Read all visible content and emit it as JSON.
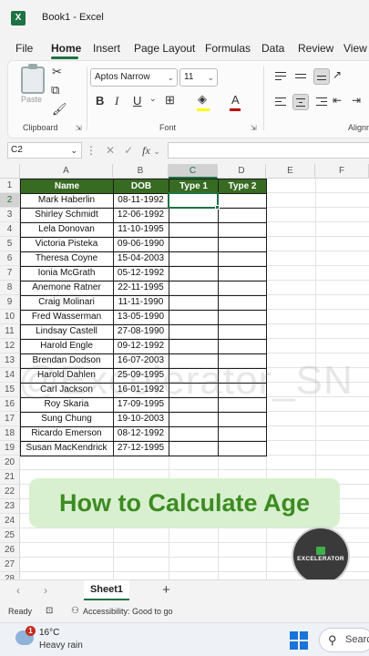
{
  "app": {
    "logo_letter": "X",
    "title": "Book1  -  Excel",
    "accent_color": "#1f7244"
  },
  "menu": {
    "tabs": [
      "File",
      "Home",
      "Insert",
      "Page Layout",
      "Formulas",
      "Data",
      "Review",
      "View"
    ],
    "active": "Home"
  },
  "ribbon": {
    "paste_label": "Paste",
    "clipboard_label": "Clipboard",
    "font_group_label": "Font",
    "alignment_label": "Alignm",
    "font_name": "Aptos Narrow",
    "font_size": "11",
    "bold": "B",
    "italic": "I",
    "underline": "U",
    "font_color_letter": "A",
    "highlight_color": "#ffff00",
    "font_color": "#c00000"
  },
  "formula_bar": {
    "name_box": "C2",
    "cancel_glyph": "✕",
    "enter_glyph": "✓",
    "fx_label": "fx",
    "formula": ""
  },
  "grid": {
    "columns": [
      "A",
      "B",
      "C",
      "D",
      "E",
      "F"
    ],
    "selected_column": "C",
    "selected_row": "2",
    "row_numbers": [
      "1",
      "2",
      "3",
      "4",
      "5",
      "6",
      "7",
      "8",
      "9",
      "10",
      "11",
      "12",
      "13",
      "14",
      "15",
      "16",
      "17",
      "18",
      "19",
      "20",
      "21",
      "22",
      "23",
      "24",
      "25",
      "26",
      "27",
      "28"
    ],
    "headers": [
      "Name",
      "DOB",
      "Type 1",
      "Type 2"
    ],
    "header_fill": "#376b22",
    "rows": [
      [
        "Mark Haberlin",
        "08-11-1992"
      ],
      [
        "Shirley Schmidt",
        "12-06-1992"
      ],
      [
        "Lela Donovan",
        "11-10-1995"
      ],
      [
        "Victoria Pisteka",
        "09-06-1990"
      ],
      [
        "Theresa Coyne",
        "15-04-2003"
      ],
      [
        "Ionia McGrath",
        "05-12-1992"
      ],
      [
        "Anemone Ratner",
        "22-11-1995"
      ],
      [
        "Craig Molinari",
        "11-11-1990"
      ],
      [
        "Fred Wasserman",
        "13-05-1990"
      ],
      [
        "Lindsay Castell",
        "27-08-1990"
      ],
      [
        "Harold Engle",
        "09-12-1992"
      ],
      [
        "Brendan Dodson",
        "16-07-2003"
      ],
      [
        "Harold Dahlen",
        "25-09-1995"
      ],
      [
        "Carl Jackson",
        "16-01-1992"
      ],
      [
        "Roy Skaria",
        "17-09-1995"
      ],
      [
        "Sung Chung",
        "19-10-2003"
      ],
      [
        "Ricardo Emerson",
        "08-12-1992"
      ],
      [
        "Susan MacKendrick",
        "27-12-1995"
      ]
    ]
  },
  "overlay": {
    "title": "How to Calculate Age",
    "watermark": "@Excelerator_SN",
    "brand": "EXCELERATOR"
  },
  "sheet_tabs": {
    "tabs": [
      "Sheet1"
    ],
    "add": "+"
  },
  "status": {
    "ready": "Ready",
    "accessibility": "Accessibility: Good to go"
  },
  "taskbar": {
    "notification_count": "1",
    "temperature": "16°C",
    "condition": "Heavy rain",
    "search_label": "Search"
  }
}
